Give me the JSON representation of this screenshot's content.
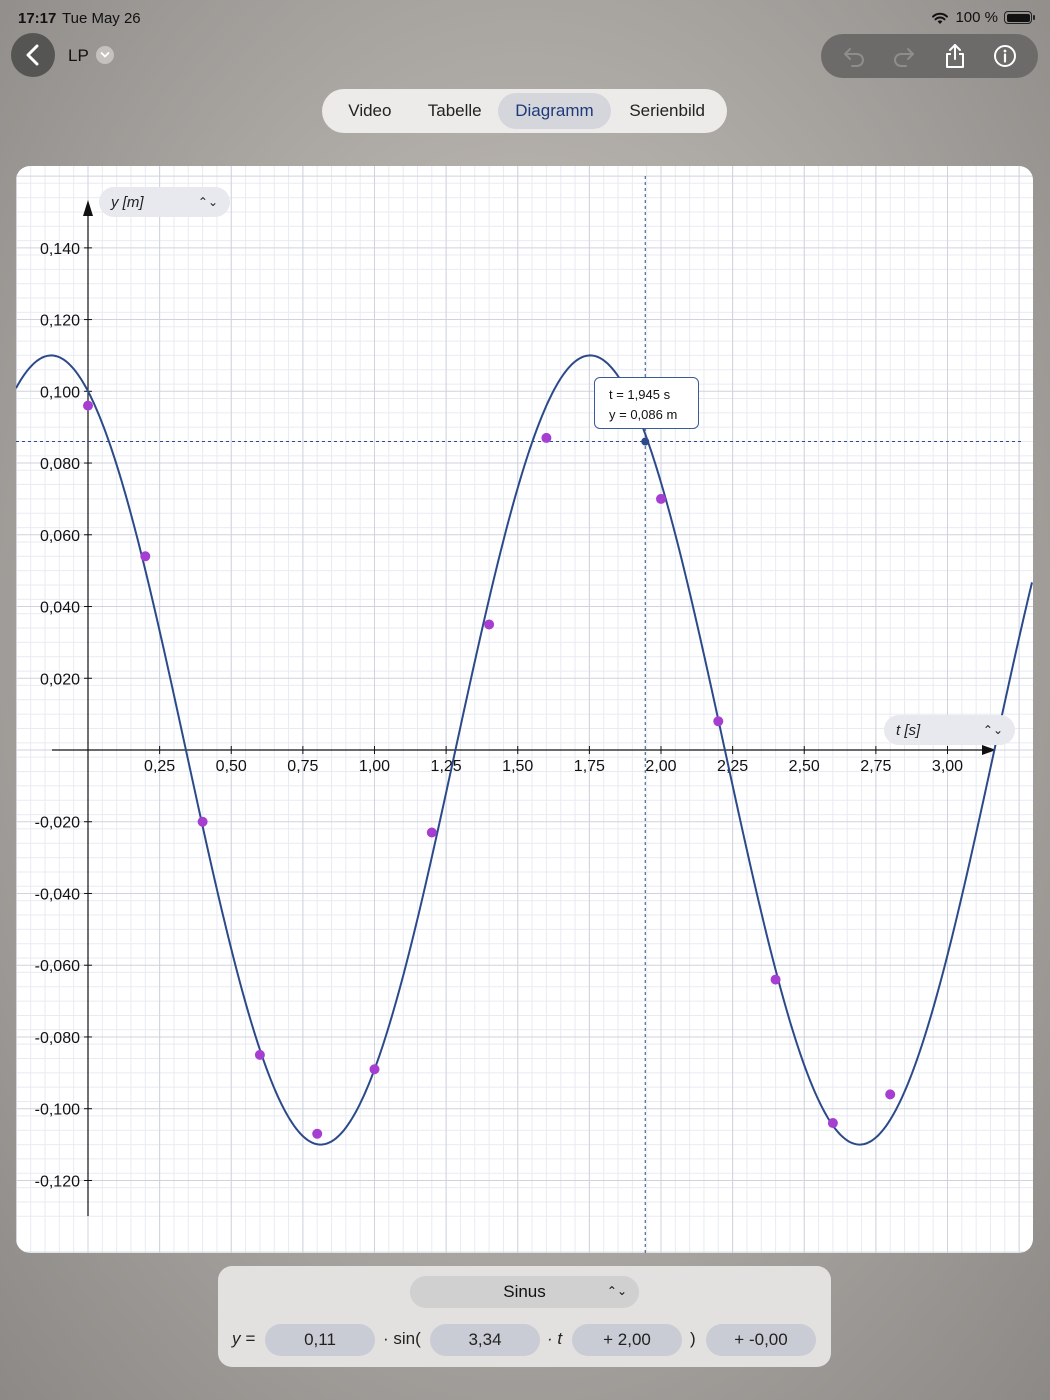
{
  "status_bar": {
    "time": "17:17",
    "date": "Tue May 26",
    "battery": "100 %"
  },
  "nav": {
    "title": "LP",
    "back_icon": "chevron-left-icon",
    "toolbar_icons": [
      "undo-icon",
      "redo-icon",
      "share-icon",
      "info-icon"
    ]
  },
  "tabs": [
    {
      "label": "Video",
      "active": false
    },
    {
      "label": "Tabelle",
      "active": false
    },
    {
      "label": "Diagramm",
      "active": true
    },
    {
      "label": "Serienbild",
      "active": false
    }
  ],
  "chart": {
    "y_axis_select": "y [m]",
    "x_axis_select": "t [s]",
    "tooltip": {
      "t": "t = 1,945 s",
      "y": "y = 0,086 m"
    }
  },
  "chart_data": {
    "type": "scatter",
    "xlabel": "t [s]",
    "ylabel": "y [m]",
    "xlim": [
      -0.25,
      3.3
    ],
    "ylim": [
      -0.131,
      0.155
    ],
    "x_ticks": [
      "0,25",
      "0,50",
      "0,75",
      "1,00",
      "1,25",
      "1,50",
      "1,75",
      "2,00",
      "2,25",
      "2,50",
      "2,75",
      "3,00"
    ],
    "y_ticks": [
      "0,140",
      "0,120",
      "0,100",
      "0,080",
      "0,060",
      "0,040",
      "0,020",
      "-0,020",
      "-0,040",
      "-0,060",
      "-0,080",
      "-0,100",
      "-0,120"
    ],
    "grid": true,
    "series": [
      {
        "points": [
          [
            0.0,
            0.096
          ],
          [
            0.2,
            0.054
          ],
          [
            0.4,
            -0.02
          ],
          [
            0.6,
            -0.085
          ],
          [
            0.8,
            -0.107
          ],
          [
            1.0,
            -0.089
          ],
          [
            1.2,
            -0.023
          ],
          [
            1.4,
            0.035
          ],
          [
            1.6,
            0.087
          ],
          [
            2.0,
            0.07
          ],
          [
            2.2,
            0.008
          ],
          [
            2.4,
            -0.064
          ],
          [
            2.6,
            -0.104
          ],
          [
            2.8,
            -0.096
          ]
        ],
        "color": "#a63fd1"
      },
      {
        "fit": "sinus",
        "amplitude": 0.11,
        "omega": 3.34,
        "phase": 2.0,
        "offset": 0.0,
        "color": "#2c4a8a"
      }
    ],
    "cursor": {
      "t": 1.945,
      "y": 0.086
    }
  },
  "formula": {
    "fit_type": "Sinus",
    "y_label": "y =",
    "amplitude": "0,11",
    "sin_label": "· sin(",
    "omega": "3,34",
    "t_label": "· t",
    "phase": "+ 2,00",
    "close_label": ")",
    "offset": "+ -0,00"
  }
}
